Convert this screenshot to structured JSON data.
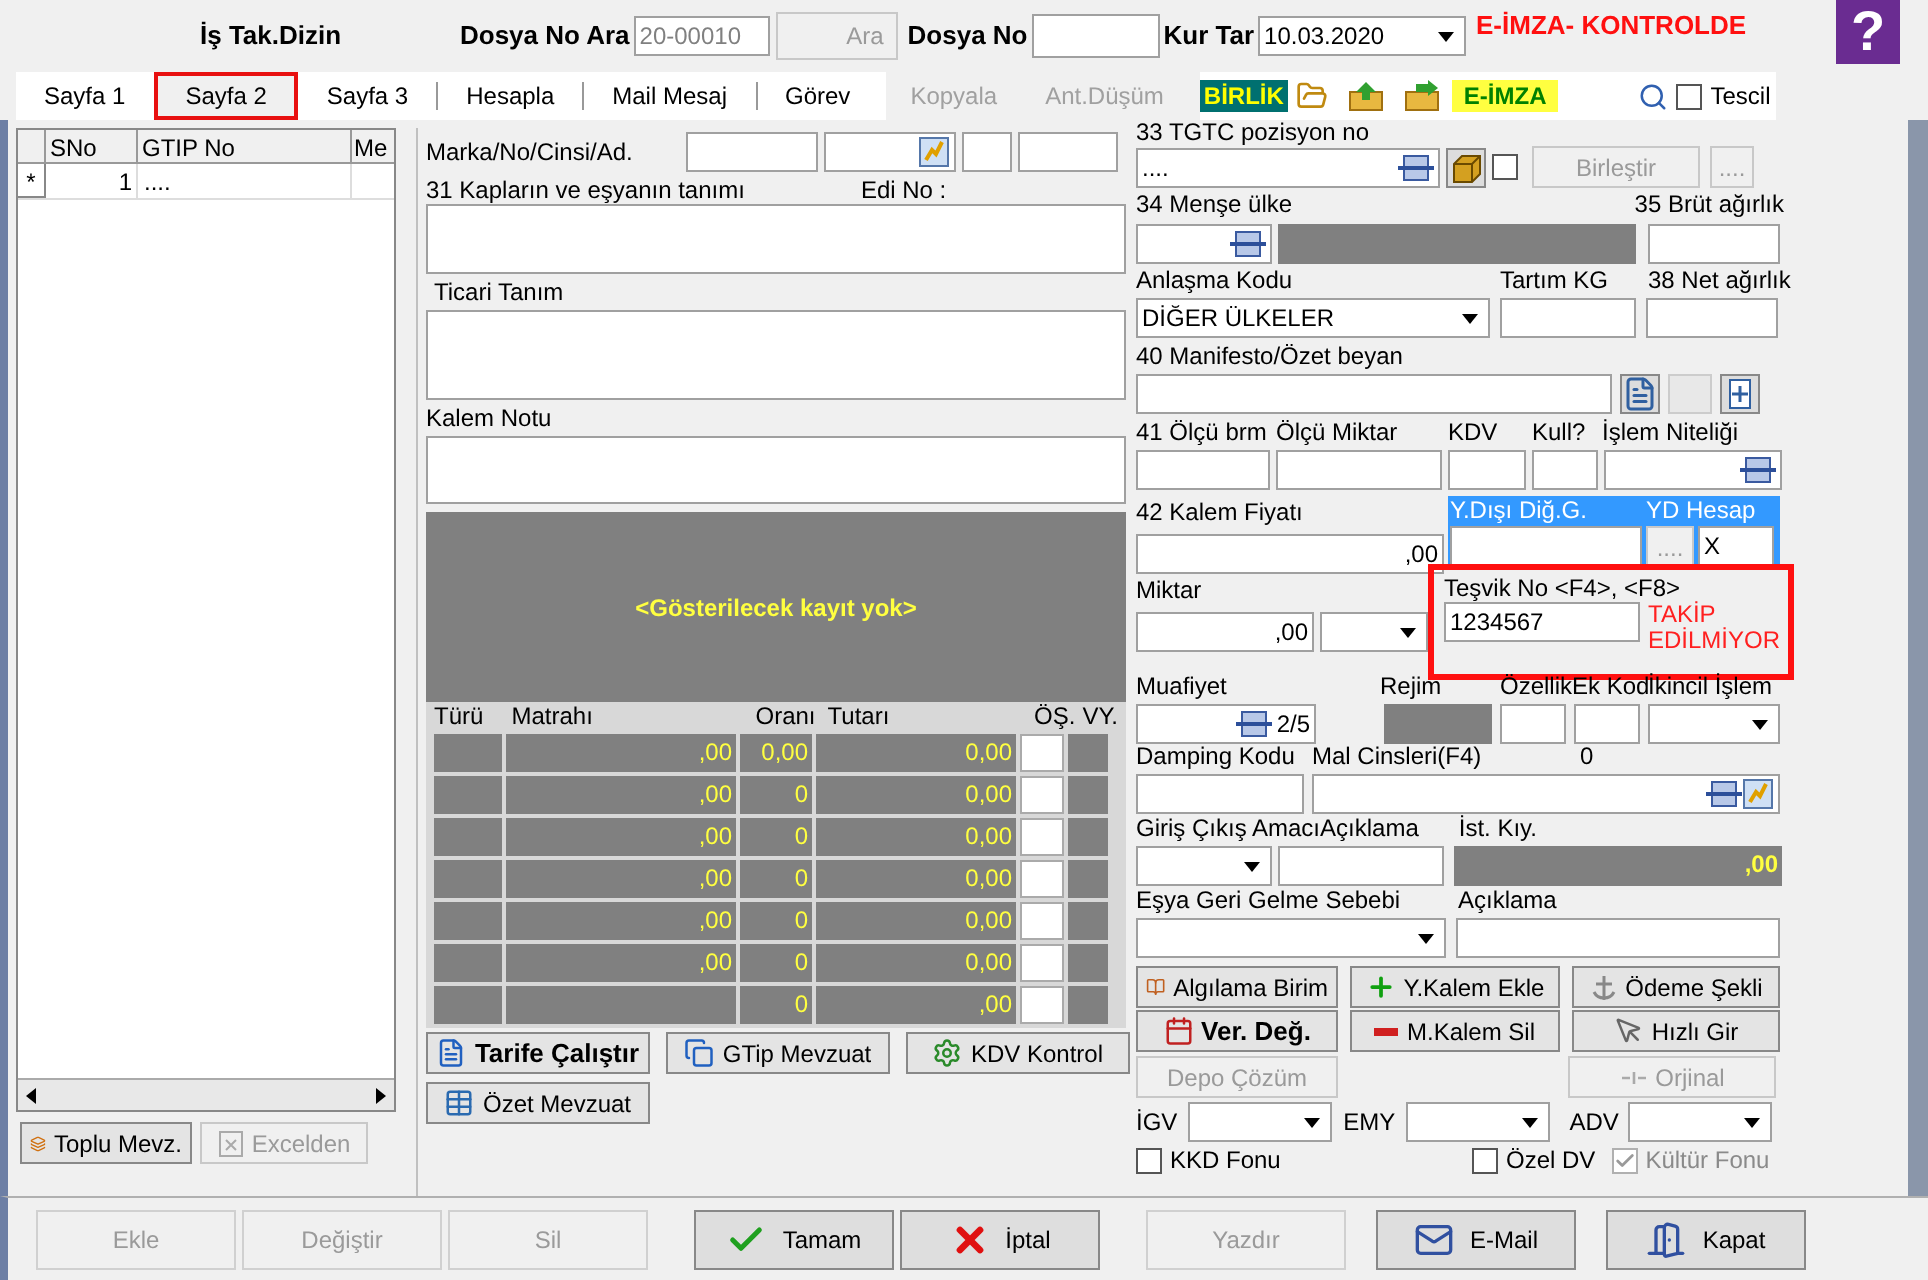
{
  "header": {
    "title": "İş Tak.Dizin",
    "search_label": "Dosya No Ara",
    "search_value": "20-00010",
    "search_button": "Ara",
    "file_label": "Dosya No",
    "rate_label": "Kur Tar",
    "rate_date": "10.03.2020",
    "signature_status": "E-İMZA- KONTROLDE",
    "help": "?"
  },
  "tabs": [
    {
      "label": "Sayfa 1",
      "selected": false
    },
    {
      "label": "Sayfa 2",
      "selected": true
    },
    {
      "label": "Sayfa 3",
      "selected": false
    },
    {
      "label": "Hesapla",
      "selected": false
    },
    {
      "label": "Mail Mesaj",
      "selected": false
    },
    {
      "label": "Görev",
      "selected": false
    }
  ],
  "toolbar": {
    "actions": [
      {
        "label": "Kopyala",
        "disabled": true
      },
      {
        "label": "Ant.Düşüm",
        "disabled": true
      }
    ],
    "union_badge": "BİRLİK",
    "esign_badge": "E-İMZA",
    "registration": {
      "label": "Tescil",
      "checked": false
    }
  },
  "items_grid": {
    "columns": [
      "SNo",
      "GTIP No",
      "Me"
    ],
    "rows": [
      {
        "marker": "*",
        "sno": "1",
        "gtip": "...."
      }
    ]
  },
  "left_buttons": [
    {
      "label": "Toplu Mevz.",
      "disabled": false
    },
    {
      "label": "Excelden",
      "disabled": true
    }
  ],
  "description": {
    "brand_label": "Marka/No/Cinsi/Ad.",
    "goods_label": "31 Kapların ve eşyanın tanımı",
    "edi_label": "Edi No :",
    "trade_label": "Ticari Tanım",
    "note_label": "Kalem Notu",
    "empty_message": "<Gösterilecek kayıt yok>"
  },
  "tax_table": {
    "columns": [
      "Türü",
      "Matrahı",
      "Oranı",
      "Tutarı",
      "ÖŞ.",
      "VY."
    ],
    "rows": [
      {
        "matrahi": ",00",
        "orani": "0,00",
        "tutari": "0,00"
      },
      {
        "matrahi": ",00",
        "orani": "0",
        "tutari": "0,00"
      },
      {
        "matrahi": ",00",
        "orani": "0",
        "tutari": "0,00"
      },
      {
        "matrahi": ",00",
        "orani": "0",
        "tutari": "0,00"
      },
      {
        "matrahi": ",00",
        "orani": "0",
        "tutari": "0,00"
      },
      {
        "matrahi": ",00",
        "orani": "0",
        "tutari": "0,00"
      },
      {
        "orani": "0",
        "tutari": ",00"
      }
    ]
  },
  "middle_buttons": [
    {
      "label": "Tarife Çalıştır",
      "emphasis": true
    },
    {
      "label": "GTip Mevzuat",
      "emphasis": false
    },
    {
      "label": "KDV Kontrol",
      "emphasis": false
    },
    {
      "label": "Özet Mevzuat",
      "emphasis": false
    }
  ],
  "position": {
    "label": "33 TGTC pozisyon no",
    "value": "....",
    "checked": false,
    "merge_button": "Birleştir",
    "more_button": "...."
  },
  "origin": {
    "label": "34 Menşe ülke"
  },
  "gross": {
    "label": "35 Brüt ağırlık"
  },
  "agreement": {
    "label": "Anlaşma Kodu",
    "value": "DİĞER ÜLKELER"
  },
  "tare": {
    "label": "Tartım KG"
  },
  "net": {
    "label": "38 Net ağırlık"
  },
  "manifest": {
    "label": "40 Manifesto/Özet beyan"
  },
  "measure_labels": [
    "41 Ölçü brm",
    "Ölçü Miktar",
    "KDV",
    "Kull?",
    "İşlem Niteliği"
  ],
  "price": {
    "label": "42 Kalem Fiyatı",
    "value": ",00"
  },
  "foreign": {
    "other_label": "Y.Dışı Diğ.G.",
    "account_label": "YD Hesap",
    "account_button": "....",
    "account_value": "X"
  },
  "quantity": {
    "label": "Miktar",
    "value": ",00"
  },
  "incentive": {
    "label": "Teşvik No <F4>, <F8>",
    "value": "1234567",
    "status": "TAKİP EDİLMİYOR"
  },
  "exempt_labels": [
    "Muafiyet",
    "Rejim",
    "Özellik",
    "Ek Kod",
    "İkincil İşlem"
  ],
  "exempt_counter": "2/5",
  "extra_code_value": "0",
  "dumping": {
    "label": "Damping Kodu"
  },
  "goods_types": {
    "label": "Mal Cinsleri(F4)"
  },
  "purpose": {
    "label": "Giriş Çıkış Amacı",
    "desc_label": "Açıklama"
  },
  "stat_value": {
    "label": "İst. Kıy.",
    "value": ",00"
  },
  "return_reason": {
    "label": "Eşya Geri Gelme Sebebi",
    "desc_label": "Açıklama"
  },
  "action_buttons": [
    {
      "label": "Algılama Birim",
      "disabled": false,
      "emphasis": false
    },
    {
      "label": "Y.Kalem Ekle",
      "disabled": false,
      "emphasis": false
    },
    {
      "label": "Ödeme Şekli",
      "disabled": false,
      "emphasis": false
    },
    {
      "label": "Ver. Değ.",
      "disabled": false,
      "emphasis": true
    },
    {
      "label": "M.Kalem Sil",
      "disabled": false,
      "emphasis": false
    },
    {
      "label": "Hızlı Gir",
      "disabled": false,
      "emphasis": false
    },
    {
      "label": "Depo Çözüm",
      "disabled": true,
      "emphasis": false
    },
    {
      "label": "Orjinal",
      "disabled": true,
      "emphasis": false
    }
  ],
  "levies": [
    {
      "label": "İGV"
    },
    {
      "label": "EMY"
    },
    {
      "label": "ADV"
    }
  ],
  "funds": [
    {
      "label": "KKD Fonu",
      "checked": false,
      "disabled": false
    },
    {
      "label": "Özel DV",
      "checked": false,
      "disabled": false
    },
    {
      "label": "Kültür Fonu",
      "checked": true,
      "disabled": true
    }
  ],
  "bottom_buttons": [
    {
      "label": "Ekle",
      "disabled": true
    },
    {
      "label": "Değiştir",
      "disabled": true
    },
    {
      "label": "Sil",
      "disabled": true
    },
    {
      "label": "Tamam",
      "disabled": false
    },
    {
      "label": "İptal",
      "disabled": false
    },
    {
      "label": "Yazdır",
      "disabled": true
    },
    {
      "label": "E-Mail",
      "disabled": false
    },
    {
      "label": "Kapat",
      "disabled": false
    }
  ]
}
